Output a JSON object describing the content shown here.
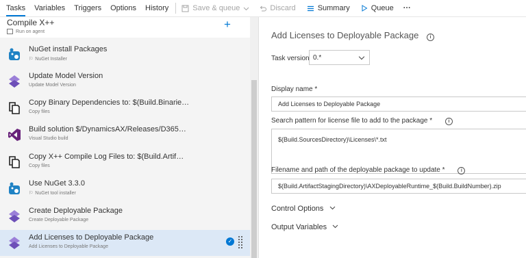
{
  "toolbar": {
    "tabs": [
      "Tasks",
      "Variables",
      "Triggers",
      "Options",
      "History"
    ],
    "save_label": "Save & queue",
    "discard_label": "Discard",
    "summary_label": "Summary",
    "queue_label": "Queue",
    "more_label": "···"
  },
  "phase": {
    "title": "Compile X++",
    "subtitle": "Run on agent"
  },
  "tasks": [
    {
      "title": "NuGet install Packages",
      "subtitle": "NuGet Installer",
      "icon": "nuget-icon",
      "flag": true
    },
    {
      "title": "Update Model Version",
      "subtitle": "Update Model Version",
      "icon": "dynamics-diamond-icon",
      "flag": false
    },
    {
      "title": "Copy Binary Dependencies to: $(Build.Binarie…",
      "subtitle": "Copy files",
      "icon": "copy-files-icon",
      "flag": false
    },
    {
      "title": "Build solution $/DynamicsAX/Releases/D365…",
      "subtitle": "Visual Studio build",
      "icon": "visual-studio-icon",
      "flag": false
    },
    {
      "title": "Copy X++ Compile Log Files to: $(Build.Artif…",
      "subtitle": "Copy files",
      "icon": "copy-files-icon",
      "flag": false
    },
    {
      "title": "Use NuGet 3.3.0",
      "subtitle": "NuGet tool installer",
      "icon": "nuget-icon",
      "flag": true
    },
    {
      "title": "Create Deployable Package",
      "subtitle": "Create Deployable Package",
      "icon": "dynamics-diamond-icon",
      "flag": false
    },
    {
      "title": "Add Licenses to Deployable Package",
      "subtitle": "Add Licenses to Deployable Package",
      "icon": "dynamics-diamond-icon",
      "flag": false
    }
  ],
  "details": {
    "title": "Add Licenses to Deployable Package",
    "task_version_label": "Task version",
    "task_version_value": "0.*",
    "display_name_label": "Display name *",
    "display_name_value": "Add Licenses to Deployable Package",
    "search_pattern_label": "Search pattern for license file to add to the package *",
    "search_pattern_value": "$(Build.SourcesDirectory)\\Licenses\\*.txt",
    "filename_label": "Filename and path of the deployable package to update *",
    "filename_value": "$(Build.ArtifactStagingDirectory)\\AXDeployableRuntime_$(Build.BuildNumber).zip",
    "control_options_label": "Control Options",
    "output_variables_label": "Output Variables"
  },
  "colors": {
    "accent": "#0078d4",
    "selected_row": "#dce8f6",
    "sidebar_bg": "#f4f4f4",
    "dynamics_purple": "#7b5cc4",
    "vs_purple": "#68217a"
  }
}
